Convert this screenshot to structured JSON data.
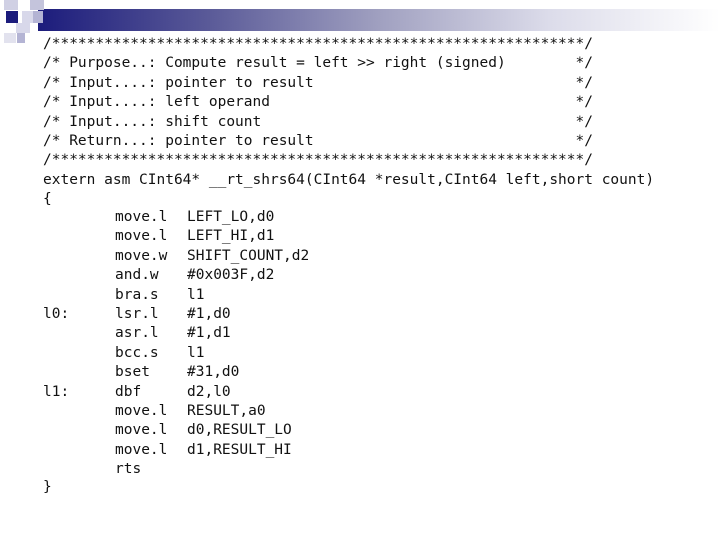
{
  "header_lines": [
    "/*************************************************************/",
    "/* Purpose..: Compute result = left >> right (signed)        */",
    "/* Input....: pointer to result                              */",
    "/* Input....: left operand                                   */",
    "/* Input....: shift count                                    */",
    "/* Return...: pointer to result                              */",
    "/*************************************************************/",
    "extern asm CInt64* __rt_shrs64(CInt64 *result,CInt64 left,short count)",
    "{"
  ],
  "code": [
    {
      "label": "",
      "op": "move.l",
      "arg": "LEFT_LO,d0"
    },
    {
      "label": "",
      "op": "move.l",
      "arg": "LEFT_HI,d1"
    },
    {
      "label": "",
      "op": "move.w",
      "arg": "SHIFT_COUNT,d2"
    },
    {
      "label": "",
      "op": "and.w",
      "arg": "#0x003F,d2"
    },
    {
      "label": "",
      "op": "bra.s",
      "arg": "l1"
    },
    {
      "label": "l0:",
      "op": "lsr.l",
      "arg": "#1,d0"
    },
    {
      "label": "",
      "op": "asr.l",
      "arg": "#1,d1"
    },
    {
      "label": "",
      "op": "bcc.s",
      "arg": "l1"
    },
    {
      "label": "",
      "op": "bset",
      "arg": "#31,d0"
    },
    {
      "label": "l1:",
      "op": "dbf",
      "arg": "d2,l0"
    },
    {
      "label": "",
      "op": "move.l",
      "arg": "RESULT,a0"
    },
    {
      "label": "",
      "op": "move.l",
      "arg": "d0,RESULT_LO"
    },
    {
      "label": "",
      "op": "move.l",
      "arg": "d1,RESULT_HI"
    },
    {
      "label": "",
      "op": "rts",
      "arg": ""
    }
  ],
  "closing": "}",
  "colors": {
    "accent": "#1c1c7c",
    "light": "#b4b4d4"
  }
}
